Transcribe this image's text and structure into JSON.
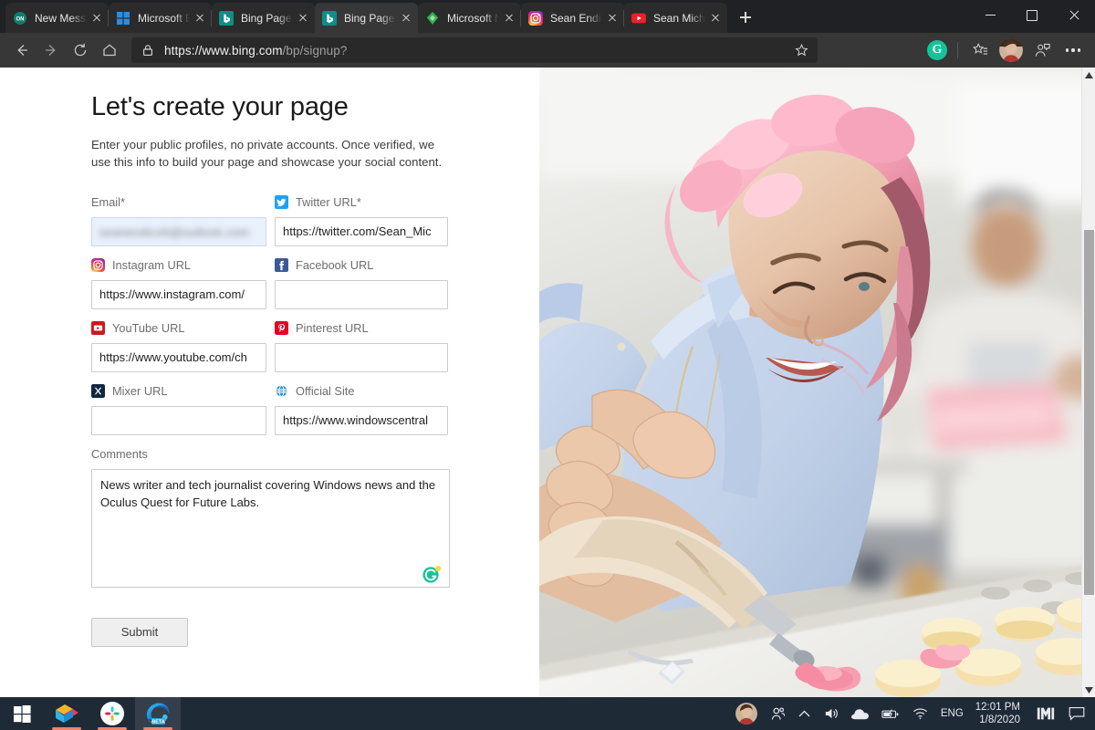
{
  "browser": {
    "tabs": [
      {
        "title": "New Messagin",
        "favicon": "onenote-icon",
        "active": false
      },
      {
        "title": "Microsoft Edg",
        "favicon": "microsoft-icon",
        "active": false
      },
      {
        "title": "Bing Page Sig",
        "favicon": "bing-icon",
        "active": false
      },
      {
        "title": "Bing Page Sig",
        "favicon": "bing-icon",
        "active": true
      },
      {
        "title": "Microsoft Nev",
        "favicon": "feedly-icon",
        "active": false
      },
      {
        "title": "Sean Endicott",
        "favicon": "instagram-icon",
        "active": false
      },
      {
        "title": "Sean Michael",
        "favicon": "youtube-icon",
        "active": false
      }
    ],
    "new_tab_label": "+",
    "window_controls": {
      "minimize": "–",
      "maximize": "□",
      "close": "×"
    },
    "toolbar": {
      "back": "back-arrow",
      "forward": "forward-arrow",
      "refresh": "refresh",
      "home": "home",
      "url_secure": "https",
      "url_host": "://www.bing.com",
      "url_path": "/bp/signup?",
      "favorite_label": "Add to favorites",
      "grammarly_label": "G",
      "favorites_label": "Favorites",
      "collections_label": "Collections",
      "settings_label": "Settings and more"
    }
  },
  "page": {
    "heading": "Let's create your page",
    "subtitle": "Enter your public profiles, no private accounts. Once verified, we use this info to build your page and showcase your social content.",
    "fields": [
      {
        "label": "Email*",
        "icon": null,
        "value": "",
        "redacted_value": "seanendicott@outlook.com",
        "autofill": true,
        "name": "email-field"
      },
      {
        "label": "Twitter URL*",
        "icon": "twitter-icon",
        "value": "https://twitter.com/Sean_Mic",
        "autofill": false,
        "name": "twitter-url-field"
      },
      {
        "label": "Instagram URL",
        "icon": "instagram-icon",
        "value": "https://www.instagram.com/",
        "autofill": false,
        "name": "instagram-url-field"
      },
      {
        "label": "Facebook URL",
        "icon": "facebook-icon",
        "value": "",
        "autofill": false,
        "name": "facebook-url-field"
      },
      {
        "label": "YouTube URL",
        "icon": "youtube-icon",
        "value": "https://www.youtube.com/ch",
        "autofill": false,
        "name": "youtube-url-field"
      },
      {
        "label": "Pinterest URL",
        "icon": "pinterest-icon",
        "value": "",
        "autofill": false,
        "name": "pinterest-url-field"
      },
      {
        "label": "Mixer URL",
        "icon": "mixer-icon",
        "value": "",
        "autofill": false,
        "name": "mixer-url-field"
      },
      {
        "label": "Official Site",
        "icon": "globe-icon",
        "value": "https://www.windowscentral",
        "autofill": false,
        "name": "official-site-field"
      }
    ],
    "comments": {
      "label": "Comments",
      "value": "News writer and tech journalist covering Windows news and the Oculus Quest for Future Labs.",
      "grammarly_badge": "grammarly-icon"
    },
    "submit_label": "Submit",
    "hero_image_alt": "Baker with pink hair piping pink frosting onto macarons"
  },
  "taskbar": {
    "start_label": "Start",
    "apps": [
      {
        "name": "paint-3d-icon",
        "active": false,
        "running": true
      },
      {
        "name": "slack-icon",
        "active": false,
        "running": true
      },
      {
        "name": "edge-beta-icon",
        "active": true,
        "running": true,
        "badge": "BETA"
      }
    ],
    "tray": {
      "people_label": "People",
      "show_hidden_label": "Show hidden icons",
      "volume_label": "Volume",
      "onedrive_label": "OneDrive",
      "battery_label": "Battery",
      "network_label": "Network",
      "language": "ENG",
      "time": "12:01 PM",
      "date": "1/8/2020",
      "todo_label": "Microsoft To Do",
      "notifications_label": "Notifications"
    }
  },
  "colors": {
    "tab_bar_bg": "#202124",
    "toolbar_bg": "#373737",
    "active_tab_bg": "#373737",
    "taskbar_bg": "#1f2a37",
    "twitter": "#1da1f2",
    "facebook": "#3b5998",
    "youtube": "#cc181e",
    "pinterest": "#e60023",
    "mixer": "#12263f",
    "grammarly_green": "#15c39a",
    "accent_underline": "#f1836a"
  }
}
